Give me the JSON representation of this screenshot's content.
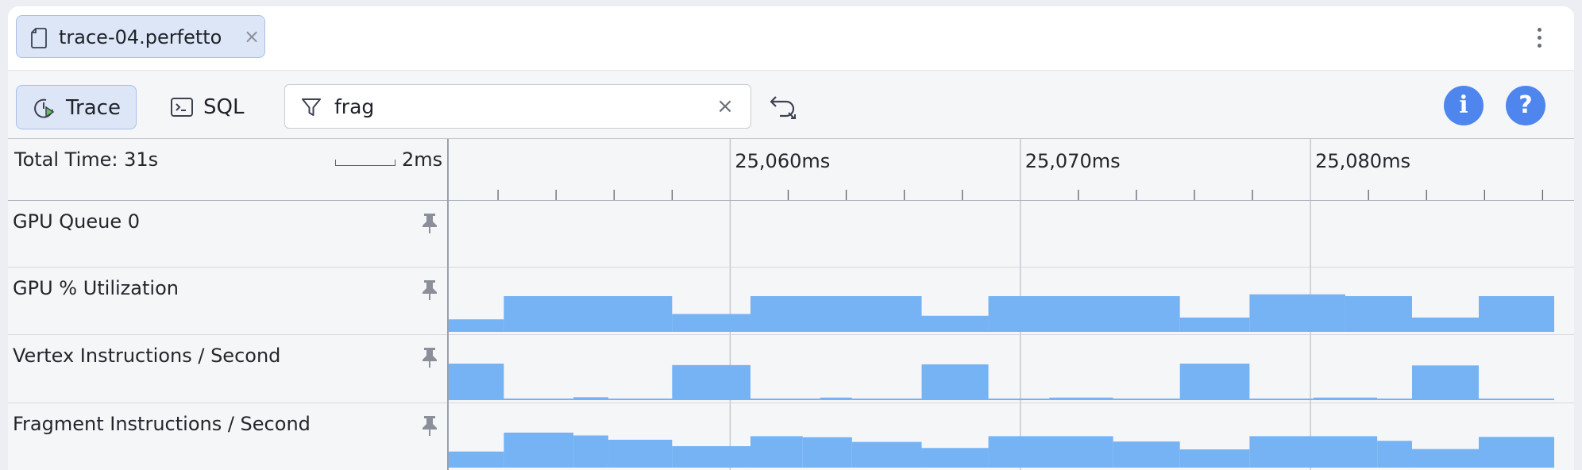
{
  "tab": {
    "title": "trace-04.perfetto",
    "close": "×"
  },
  "toolbar": {
    "trace_label": "Trace",
    "sql_label": "SQL",
    "filter_value": "frag",
    "filter_clear": "×",
    "info_label": "i",
    "help_label": "?"
  },
  "timeline": {
    "total_time": "Total Time: 31s",
    "scale_label": "2ms",
    "ticks": [
      "25,060ms",
      "25,070ms",
      "25,080ms"
    ]
  },
  "tracks": [
    {
      "name": "GPU Queue 0"
    },
    {
      "name": "GPU % Utilization"
    },
    {
      "name": "Vertex Instructions / Second"
    },
    {
      "name": "Fragment Instructions / Second"
    }
  ],
  "colors": {
    "accent": "#4f86ee",
    "counter_fill": "#76b3f4"
  },
  "chart_data": {
    "type": "area",
    "x_range_ms": [
      25050.3,
      25088.4
    ],
    "series": [
      {
        "name": "GPU % Utilization",
        "steps": [
          [
            25050.3,
            0.35
          ],
          [
            25052.2,
            1.0
          ],
          [
            25058.0,
            0.5
          ],
          [
            25060.7,
            1.0
          ],
          [
            25066.6,
            0.45
          ],
          [
            25068.9,
            1.0
          ],
          [
            25075.5,
            0.4
          ],
          [
            25077.9,
            1.05
          ],
          [
            25081.2,
            1.0
          ],
          [
            25083.5,
            0.4
          ],
          [
            25085.8,
            1.0
          ],
          [
            25088.4,
            1.0
          ]
        ]
      },
      {
        "name": "Vertex Instructions / Second",
        "steps": [
          [
            25050.3,
            1.0
          ],
          [
            25052.2,
            0.03
          ],
          [
            25054.6,
            0.08
          ],
          [
            25055.8,
            0.03
          ],
          [
            25058.0,
            0.96
          ],
          [
            25060.7,
            0.03
          ],
          [
            25063.1,
            0.07
          ],
          [
            25064.2,
            0.03
          ],
          [
            25066.6,
            0.98
          ],
          [
            25068.9,
            0.03
          ],
          [
            25071.0,
            0.07
          ],
          [
            25073.2,
            0.03
          ],
          [
            25075.5,
            1.0
          ],
          [
            25077.9,
            0.03
          ],
          [
            25080.1,
            0.07
          ],
          [
            25082.3,
            0.03
          ],
          [
            25083.5,
            0.95
          ],
          [
            25085.8,
            0.04
          ],
          [
            25088.4,
            0.04
          ]
        ]
      },
      {
        "name": "Fragment Instructions / Second",
        "steps": [
          [
            25050.3,
            0.45
          ],
          [
            25052.2,
            0.98
          ],
          [
            25054.6,
            0.9
          ],
          [
            25055.8,
            0.78
          ],
          [
            25058.0,
            0.6
          ],
          [
            25060.7,
            0.88
          ],
          [
            25062.5,
            0.85
          ],
          [
            25064.2,
            0.72
          ],
          [
            25066.6,
            0.55
          ],
          [
            25068.9,
            0.88
          ],
          [
            25073.2,
            0.73
          ],
          [
            25075.5,
            0.51
          ],
          [
            25077.9,
            0.88
          ],
          [
            25082.3,
            0.75
          ],
          [
            25083.5,
            0.52
          ],
          [
            25085.8,
            0.86
          ],
          [
            25088.4,
            0.86
          ]
        ]
      }
    ]
  }
}
